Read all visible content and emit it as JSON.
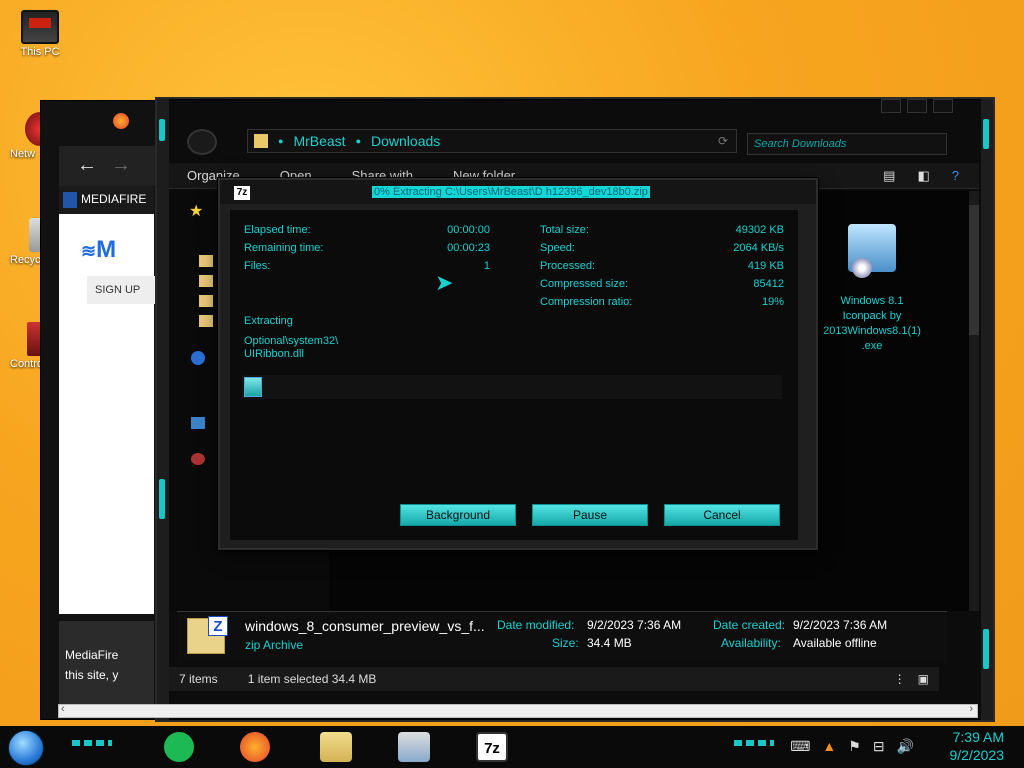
{
  "desktop": {
    "icons": [
      {
        "label": "This PC"
      },
      {
        "label": "Netw"
      },
      {
        "label": "Recyc"
      },
      {
        "label": "Control"
      }
    ]
  },
  "browser": {
    "tab_title": "MEDIAFIRE",
    "logo_text": "M",
    "signup": "SIGN UP",
    "footer_text_1": "MediaFire",
    "footer_text_2": "this site, y"
  },
  "explorer": {
    "breadcrumbs": [
      "MrBeast",
      "Downloads"
    ],
    "search_placeholder": "Search Downloads",
    "toolbar": [
      "Organize",
      "Open",
      "Share with",
      "New folder"
    ],
    "preview": {
      "name_lines": [
        "Windows 8.1",
        "Iconpack by",
        "2013Windows8.1(1)",
        ".exe"
      ]
    },
    "details": {
      "filename": "windows_8_consumer_preview_vs_f...",
      "filetype": "zip Archive",
      "date_modified_label": "Date modified:",
      "date_modified": "9/2/2023 7:36 AM",
      "size_label": "Size:",
      "size": "34.4 MB",
      "date_created_label": "Date created:",
      "date_created": "9/2/2023 7:36 AM",
      "availability_label": "Availability:",
      "availability": "Available offline"
    },
    "status": {
      "items": "7 items",
      "selected": "1 item selected  34.4 MB"
    }
  },
  "dialog": {
    "app_icon": "7z",
    "title": "0% Extracting C:\\Users\\MrBeast\\D     h12396_dev18b0.zip",
    "left": {
      "elapsed_label": "Elapsed time:",
      "elapsed": "00:00:00",
      "remaining_label": "Remaining time:",
      "remaining": "00:00:23",
      "files_label": "Files:",
      "files": "1"
    },
    "right": {
      "total_label": "Total size:",
      "total": "49302 KB",
      "speed_label": "Speed:",
      "speed": "2064 KB/s",
      "processed_label": "Processed:",
      "processed": "419 KB",
      "compressed_label": "Compressed size:",
      "compressed": "85412",
      "ratio_label": "Compression ratio:",
      "ratio": "19%"
    },
    "status_label": "Extracting",
    "current_path_1": "Optional\\system32\\",
    "current_path_2": "UIRibbon.dll",
    "progress_fraction": 0.01,
    "buttons": {
      "background": "Background",
      "pause": "Pause",
      "cancel": "Cancel"
    }
  },
  "taskbar": {
    "time": "7:39 AM",
    "date": "9/2/2023",
    "apps": [
      "spotify-app",
      "firefox-app",
      "file-explorer-app",
      "notepad-app",
      "7zip-app"
    ]
  },
  "colors": {
    "accent": "#19d1d1",
    "desktop_bg": "#f7a51f",
    "window_bg": "#0b0b0b"
  }
}
